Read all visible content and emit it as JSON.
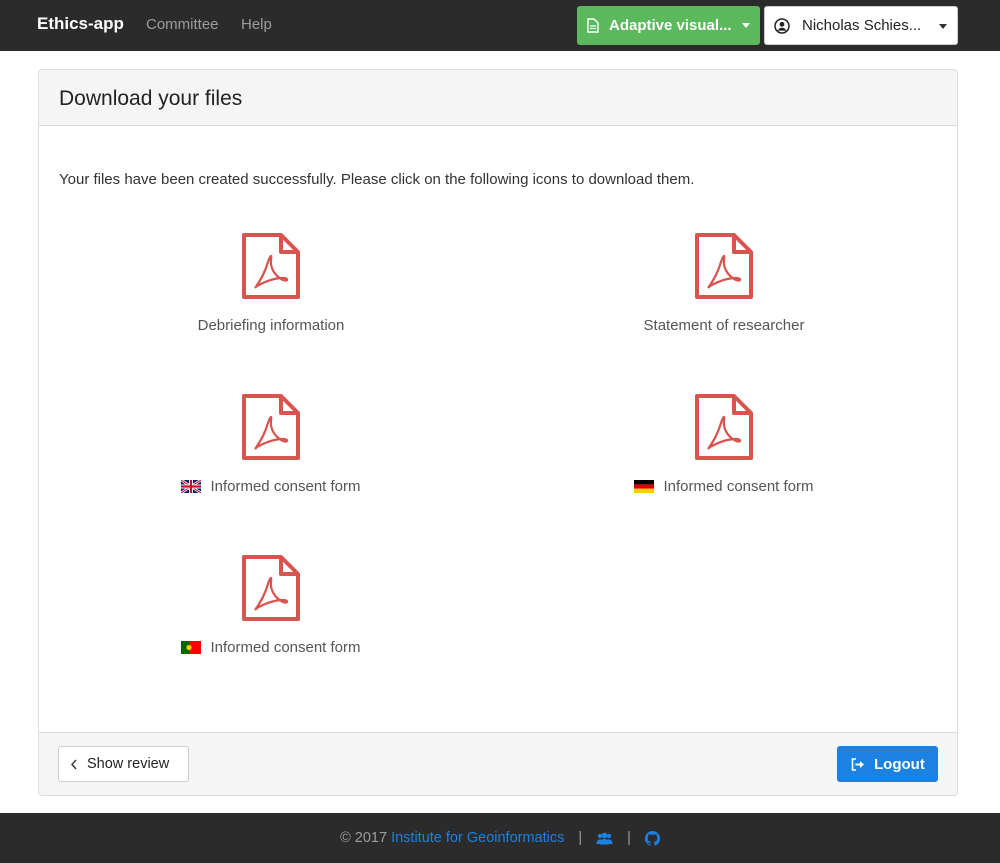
{
  "navbar": {
    "brand": "Ethics-app",
    "links": [
      "Committee",
      "Help"
    ],
    "project_button": "Adaptive visual...",
    "user_button": "Nicholas Schies...",
    "colors": {
      "background": "#2b2b2b",
      "project_button": "#5cb85c"
    }
  },
  "panel": {
    "title": "Download your files",
    "intro": "Your files have been created successfully. Please click on the following icons to download them.",
    "files": [
      {
        "label": "Debriefing information",
        "icon": "pdf-icon"
      },
      {
        "label": "Statement of researcher",
        "icon": "pdf-icon"
      },
      {
        "label": "Informed consent form",
        "icon": "pdf-icon",
        "flag": "uk-flag-icon"
      },
      {
        "label": "Informed consent form",
        "icon": "pdf-icon",
        "flag": "germany-flag-icon"
      },
      {
        "label": "Informed consent form",
        "icon": "pdf-icon",
        "flag": "portugal-flag-icon"
      }
    ],
    "pdf_color": "#d9534f"
  },
  "footer_buttons": {
    "review": "Show review",
    "logout": "Logout",
    "logout_color": "#1b82e2"
  },
  "page_footer": {
    "copyright": "© 2017",
    "institute": "Institute for Geoinformatics",
    "separator": "|",
    "icons": [
      "users-icon",
      "github-icon"
    ]
  }
}
